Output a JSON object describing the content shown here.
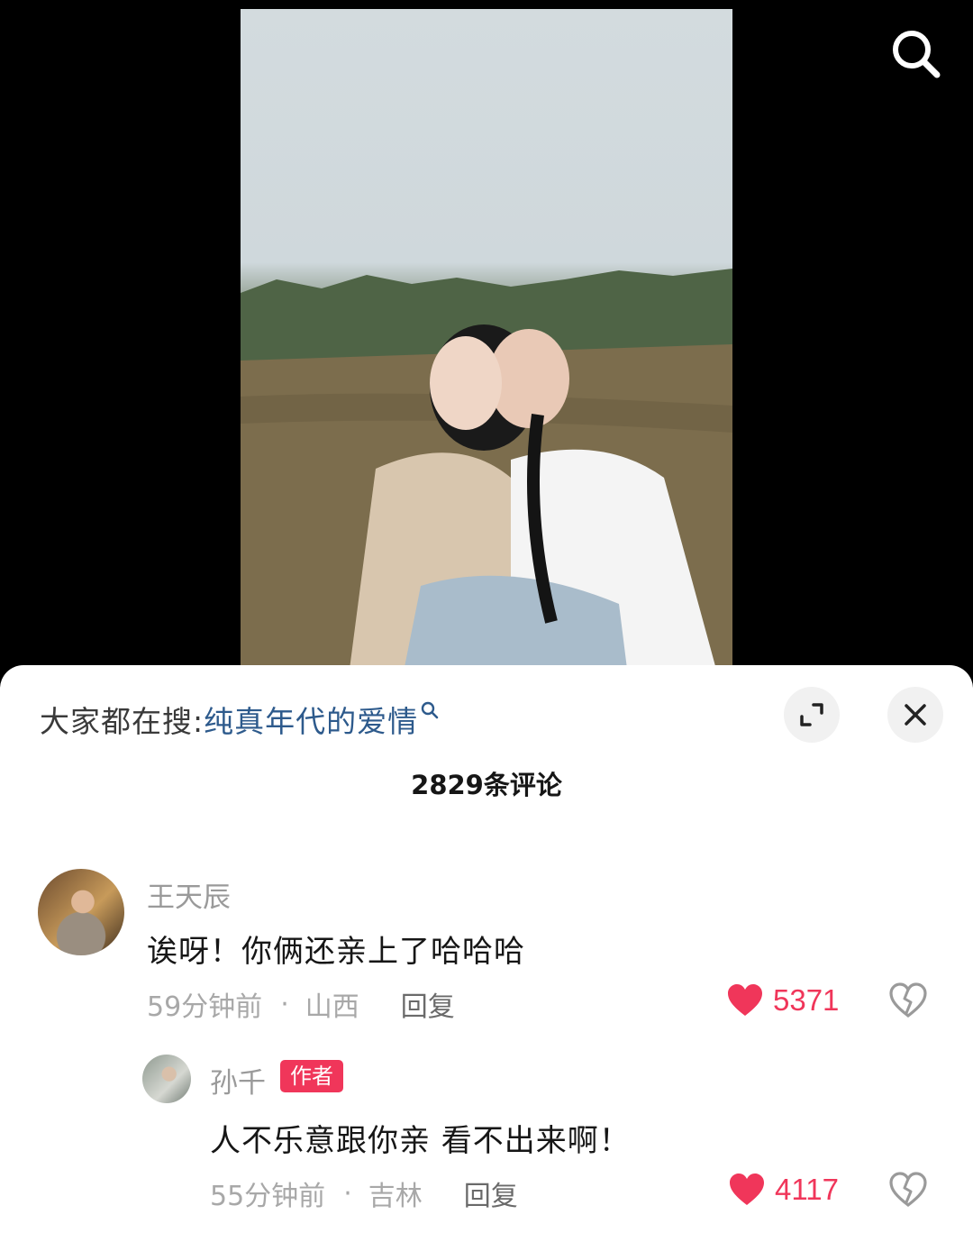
{
  "hot_search": {
    "prefix": "大家都在搜:",
    "query": "纯真年代的爱情"
  },
  "comments_header": {
    "count_label": "2829条评论"
  },
  "comments": [
    {
      "username": "王天辰",
      "text": "诶呀！你俩还亲上了哈哈哈",
      "time": "59分钟前",
      "location": "山西",
      "reply_label": "回复",
      "likes": "5371",
      "liked": true
    },
    {
      "username": "孙千",
      "badge": "作者",
      "text": "人不乐意跟你亲 看不出来啊！",
      "time": "55分钟前",
      "location": "吉林",
      "reply_label": "回复",
      "likes": "4117",
      "liked": true
    }
  ],
  "colors": {
    "accent_red": "#f0365a",
    "link_blue": "#2d5a8c"
  }
}
